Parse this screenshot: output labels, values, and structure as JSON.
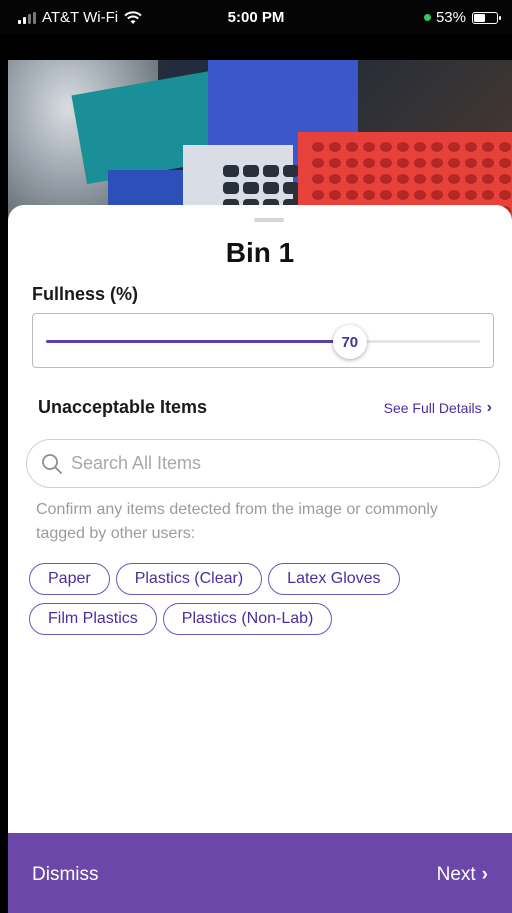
{
  "status_bar": {
    "carrier": "AT&T Wi-Fi",
    "time": "5:00 PM",
    "battery": "53%"
  },
  "sheet": {
    "title": "Bin 1",
    "fullness_label": "Fullness (%)",
    "fullness_value": 70,
    "fullness_value_text": "70",
    "section_title": "Unacceptable Items",
    "details_link": "See Full Details",
    "search_placeholder": "Search All Items",
    "hint": "Confirm any items detected from the image or commonly tagged by other users:",
    "chips": [
      "Paper",
      "Plastics (Clear)",
      "Latex Gloves",
      "Film Plastics",
      "Plastics (Non-Lab)"
    ]
  },
  "footer": {
    "dismiss_label": "Dismiss",
    "next_label": "Next"
  },
  "colors": {
    "accent": "#4b2e9c",
    "footer": "#6a47a8"
  },
  "icons": {
    "search": "search-icon",
    "wifi": "wifi-icon",
    "battery": "battery-icon",
    "chevron": "chevron-right-icon"
  }
}
